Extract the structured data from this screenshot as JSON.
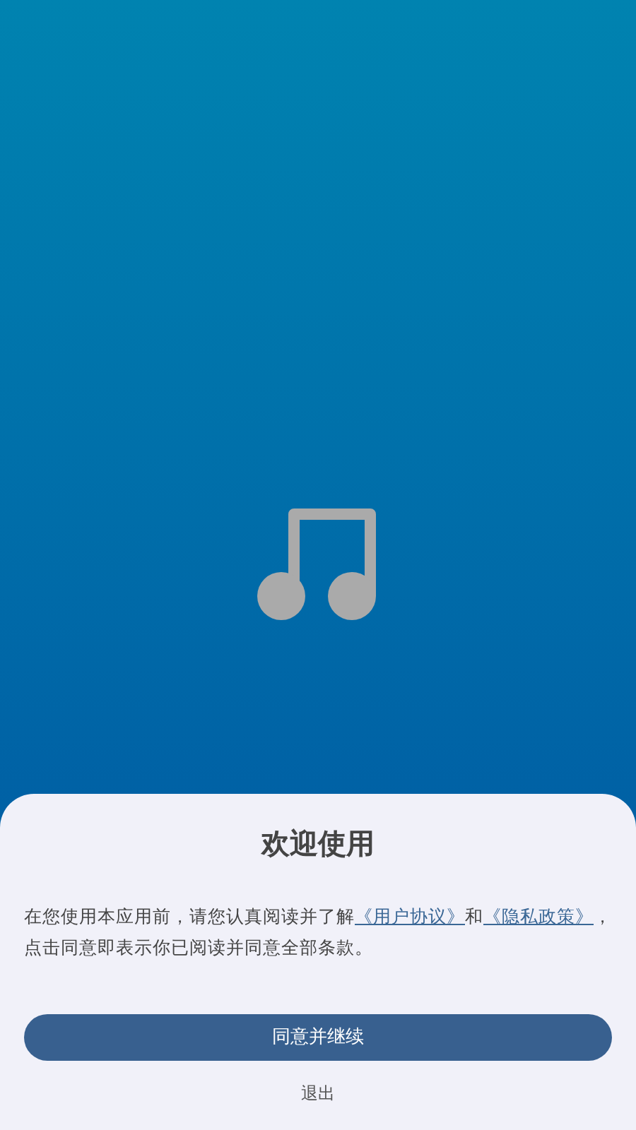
{
  "dialog": {
    "title": "欢迎使用",
    "notice": [
      {
        "kind": "text",
        "text": "在您使用本应用前，请您认真阅读并了解"
      },
      {
        "kind": "link",
        "text": "《用户协议》"
      },
      {
        "kind": "text",
        "text": "和"
      },
      {
        "kind": "link",
        "text": "《隐私政策》"
      },
      {
        "kind": "text",
        "text": "，点击同意即表示你已阅读并同意全部条款。"
      }
    ],
    "buttons": [
      {
        "kind": "primary",
        "label": "同意并继续"
      },
      {
        "kind": "text",
        "label": "退出"
      }
    ]
  }
}
